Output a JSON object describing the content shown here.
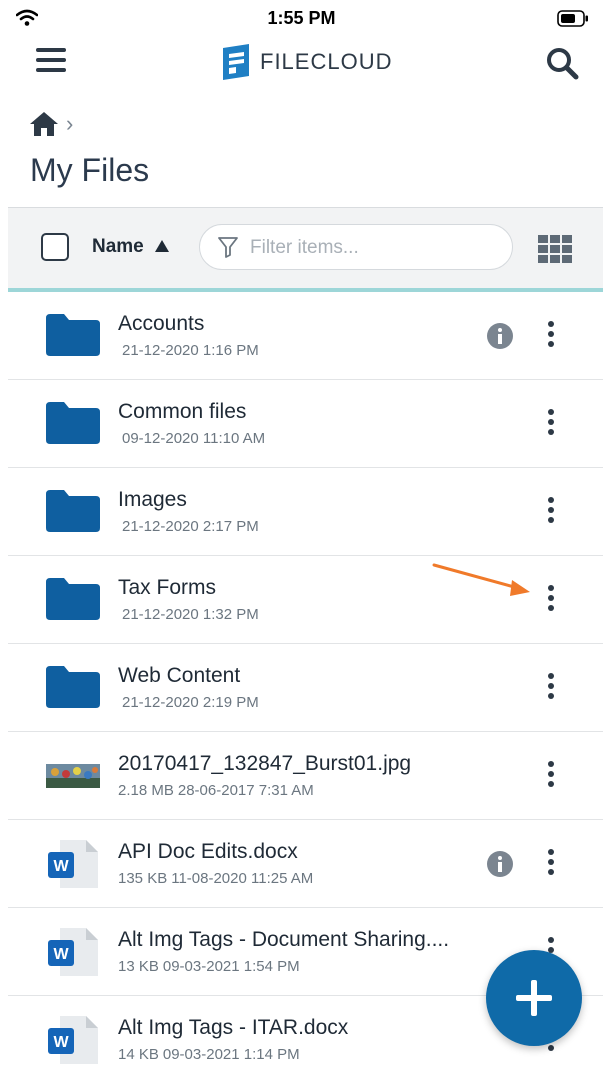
{
  "status_bar": {
    "time": "1:55 PM"
  },
  "header": {
    "logo_text": "FILECLOUD"
  },
  "page": {
    "title": "My Files"
  },
  "toolbar": {
    "sort_label": "Name",
    "filter_placeholder": "Filter items..."
  },
  "files": [
    {
      "name": "Accounts",
      "size": "",
      "date": "21-12-2020 1:16 PM",
      "type": "folder",
      "has_info": true
    },
    {
      "name": "Common files",
      "size": "",
      "date": "09-12-2020 11:10 AM",
      "type": "folder",
      "has_info": false
    },
    {
      "name": "Images",
      "size": "",
      "date": "21-12-2020 2:17 PM",
      "type": "folder",
      "has_info": false
    },
    {
      "name": "Tax Forms",
      "size": "",
      "date": "21-12-2020 1:32 PM",
      "type": "folder",
      "has_info": false
    },
    {
      "name": "Web Content",
      "size": "",
      "date": "21-12-2020 2:19 PM",
      "type": "folder",
      "has_info": false
    },
    {
      "name": "20170417_132847_Burst01.jpg",
      "size": "2.18 MB",
      "date": "28-06-2017 7:31 AM",
      "type": "image",
      "has_info": false
    },
    {
      "name": "API Doc Edits.docx",
      "size": "135 KB",
      "date": "11-08-2020 11:25 AM",
      "type": "docx",
      "has_info": true
    },
    {
      "name": "Alt Img Tags - Document Sharing....",
      "size": "13 KB",
      "date": "09-03-2021 1:54 PM",
      "type": "docx",
      "has_info": false
    },
    {
      "name": "Alt Img Tags - ITAR.docx",
      "size": "14 KB",
      "date": "09-03-2021 1:14 PM",
      "type": "docx",
      "has_info": false
    }
  ],
  "colors": {
    "folder": "#0f5fa0",
    "accent": "#0f6aa8",
    "annotation_arrow": "#f07a2a",
    "toolbar_underline": "#9dd6d8"
  },
  "icons": {
    "status": [
      "wifi-icon",
      "battery-icon"
    ],
    "header": [
      "menu-icon",
      "filecloud-logo-icon",
      "search-icon"
    ],
    "breadcrumb": [
      "home-icon",
      "chevron-right-icon"
    ],
    "toolbar": [
      "checkbox-icon",
      "sort-ascending-icon",
      "filter-icon",
      "grid-view-icon"
    ],
    "row": [
      "folder-icon",
      "image-thumbnail-icon",
      "word-document-icon",
      "info-icon",
      "more-options-icon"
    ],
    "fab": "plus-icon"
  }
}
